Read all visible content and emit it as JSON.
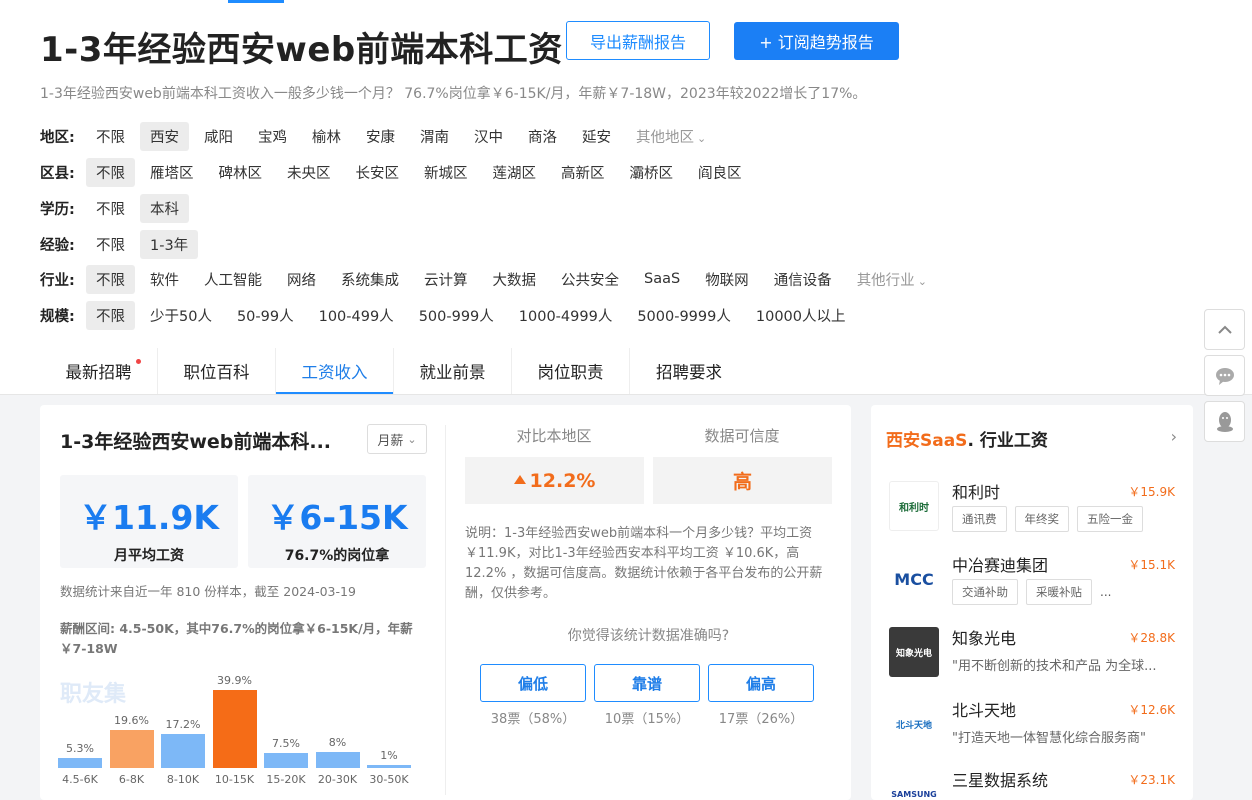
{
  "header": {
    "title": "1-3年经验西安web前端本科工资",
    "export_button": "导出薪酬报告",
    "subscribe_button": "+ 订阅趋势报告",
    "subtitle": "1-3年经验西安web前端本科工资收入一般多少钱一个月？ 76.7%岗位拿￥6-15K/月，年薪￥7-18W，2023年较2022增长了17%。"
  },
  "filters": [
    {
      "label": "地区:",
      "options": [
        "不限",
        "西安",
        "咸阳",
        "宝鸡",
        "榆林",
        "安康",
        "渭南",
        "汉中",
        "商洛",
        "延安"
      ],
      "selected": 1,
      "more": "其他地区"
    },
    {
      "label": "区县:",
      "options": [
        "不限",
        "雁塔区",
        "碑林区",
        "未央区",
        "长安区",
        "新城区",
        "莲湖区",
        "高新区",
        "灞桥区",
        "阎良区"
      ],
      "selected": 0,
      "more": ""
    },
    {
      "label": "学历:",
      "options": [
        "不限",
        "本科"
      ],
      "selected": 1,
      "more": ""
    },
    {
      "label": "经验:",
      "options": [
        "不限",
        "1-3年"
      ],
      "selected": 1,
      "more": ""
    },
    {
      "label": "行业:",
      "options": [
        "不限",
        "软件",
        "人工智能",
        "网络",
        "系统集成",
        "云计算",
        "大数据",
        "公共安全",
        "SaaS",
        "物联网",
        "通信设备"
      ],
      "selected": 0,
      "more": "其他行业"
    },
    {
      "label": "规模:",
      "options": [
        "不限",
        "少于50人",
        "50-99人",
        "100-499人",
        "500-999人",
        "1000-4999人",
        "5000-9999人",
        "10000人以上"
      ],
      "selected": 0,
      "more": ""
    }
  ],
  "tabs": [
    {
      "label": "最新招聘",
      "active": false,
      "dot": true
    },
    {
      "label": "职位百科",
      "active": false,
      "dot": false
    },
    {
      "label": "工资收入",
      "active": true,
      "dot": false
    },
    {
      "label": "就业前景",
      "active": false,
      "dot": false
    },
    {
      "label": "岗位职责",
      "active": false,
      "dot": false
    },
    {
      "label": "招聘要求",
      "active": false,
      "dot": false
    }
  ],
  "main_card": {
    "title": "1-3年经验西安web前端本科...",
    "period_select": "月薪",
    "avg_value": "￥11.9K",
    "avg_label": "月平均工资",
    "range_value": "￥6-15K",
    "range_label": "76.7%的岗位拿",
    "sample_note": "数据统计来自近一年 810 份样本，截至 2024-03-19",
    "range_note": "薪酬区间: 4.5-50K，其中76.7%的岗位拿￥6-15K/月，年薪￥7-18W",
    "watermark": "职友集",
    "compare_label": "对比本地区",
    "compare_value": "12.2%",
    "credibility_label": "数据可信度",
    "credibility_value": "高",
    "explain": "说明：1-3年经验西安web前端本科一个月多少钱？平均工资￥11.9K，对比1-3年经验西安本科平均工资 ￥10.6K，高12.2% ，数据可信度高。数据统计依赖于各平台发布的公开薪酬，仅供参考。",
    "ask": "你觉得该统计数据准确吗?",
    "votes": [
      {
        "label": "偏低",
        "count": "38票（58%）"
      },
      {
        "label": "靠谱",
        "count": "10票（15%）"
      },
      {
        "label": "偏高",
        "count": "17票（26%）"
      }
    ]
  },
  "chart_data": {
    "type": "bar",
    "categories": [
      "4.5-6K",
      "6-8K",
      "8-10K",
      "10-15K",
      "15-20K",
      "20-30K",
      "30-50K"
    ],
    "values": [
      5.3,
      19.6,
      17.2,
      39.9,
      7.5,
      8,
      1
    ],
    "value_labels": [
      "5.3%",
      "19.6%",
      "17.2%",
      "39.9%",
      "7.5%",
      "8%",
      "1%"
    ],
    "highlight": [
      false,
      true,
      false,
      true,
      false,
      false,
      false
    ],
    "colors": {
      "normal": "#7db8f7",
      "mid": "#f9a262",
      "max": "#f56c17"
    },
    "ylim": [
      0,
      40
    ]
  },
  "side_card": {
    "title_accent": "西安SaaS",
    "title_rest": ". 行业工资",
    "companies": [
      {
        "name": "和利时",
        "salary": "￥15.9K",
        "tags": [
          "通讯费",
          "年终奖",
          "五险一金"
        ],
        "slogan": "",
        "more": "",
        "logo_text": "和利时"
      },
      {
        "name": "中冶赛迪集团",
        "salary": "￥15.1K",
        "tags": [
          "交通补助",
          "采暖补贴"
        ],
        "slogan": "",
        "more": "...",
        "logo_text": "MCC"
      },
      {
        "name": "知象光电",
        "salary": "￥28.8K",
        "tags": [],
        "slogan": "\"用不断创新的技术和产品 为全球...",
        "more": "",
        "logo_text": "知象光电"
      },
      {
        "name": "北斗天地",
        "salary": "￥12.6K",
        "tags": [],
        "slogan": "\"打造天地一体智慧化综合服务商\"",
        "more": "",
        "logo_text": "北斗天地"
      },
      {
        "name": "三星数据系统",
        "salary": "￥23.1K",
        "tags": [],
        "slogan": "",
        "more": "",
        "logo_text": "SAMSUNG"
      }
    ]
  },
  "float_buttons": [
    "chevron-up-icon",
    "chat-icon",
    "qq-icon"
  ]
}
